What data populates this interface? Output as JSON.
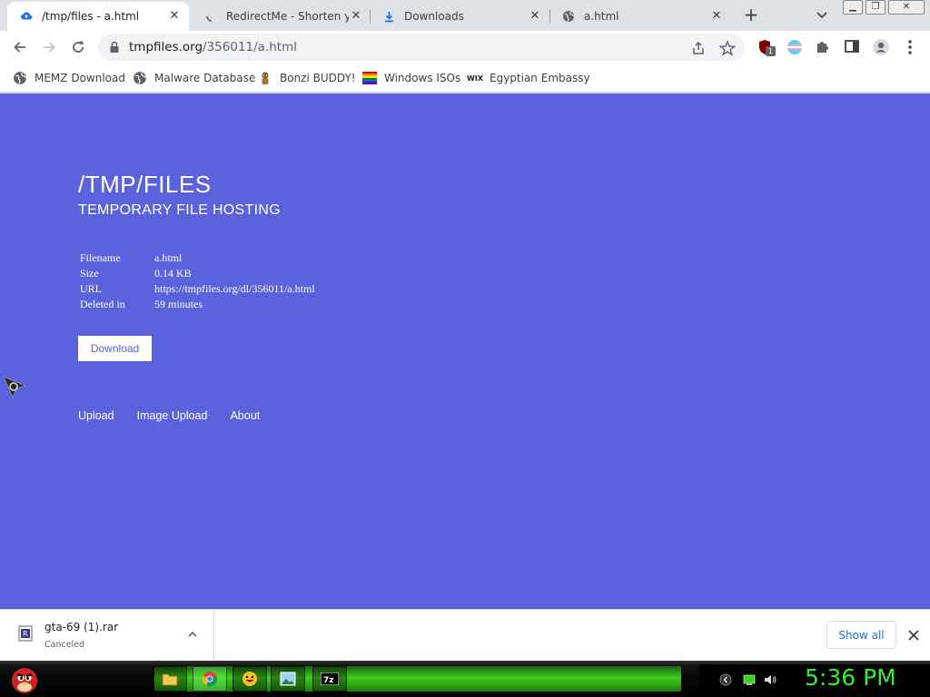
{
  "browser": {
    "tabs": [
      {
        "title": "/tmp/files - a.html",
        "active": true,
        "icon": "upload-cloud-icon"
      },
      {
        "title": "RedirectMe - Shorten you",
        "active": false,
        "icon": "loading-icon"
      },
      {
        "title": "Downloads",
        "active": false,
        "icon": "download-icon"
      },
      {
        "title": "a.html",
        "active": false,
        "icon": "globe-icon"
      }
    ],
    "new_tab_label": "+",
    "address": {
      "host": "tmpfiles.org",
      "path": "/356011/a.html"
    },
    "extension_badge": "1",
    "bookmarks": [
      {
        "label": "MEMZ Download",
        "icon": "globe-icon"
      },
      {
        "label": "Malware Database",
        "icon": "globe-icon"
      },
      {
        "label": "Bonzi BUDDY!",
        "icon": "bonzi-icon"
      },
      {
        "label": "Windows ISOs",
        "icon": "rainbow-flag-icon"
      },
      {
        "label": "Egyptian Embassy",
        "icon": "wix-icon"
      }
    ]
  },
  "page": {
    "title": "/TMP/FILES",
    "subtitle": "TEMPORARY FILE HOSTING",
    "info": [
      {
        "key": "Filename",
        "value": "a.html"
      },
      {
        "key": "Size",
        "value": "0.14 KB"
      },
      {
        "key": "URL",
        "value": "https://tmpfiles.org/dl/356011/a.html"
      },
      {
        "key": "Deleted in",
        "value": "59 minutes"
      }
    ],
    "download_label": "Download",
    "links": [
      "Upload",
      "Image Upload",
      "About"
    ],
    "background_color": "#5a63dd"
  },
  "download_bar": {
    "file_name": "gta-69 (1).rar",
    "status": "Canceled",
    "show_all_label": "Show all"
  },
  "taskbar": {
    "clock": "5:36 PM",
    "pinned": [
      "file-explorer-icon",
      "chrome-icon",
      "emoji-app-icon",
      "image-viewer-icon",
      "7zip-icon"
    ],
    "accent_color": "#2df02d"
  }
}
